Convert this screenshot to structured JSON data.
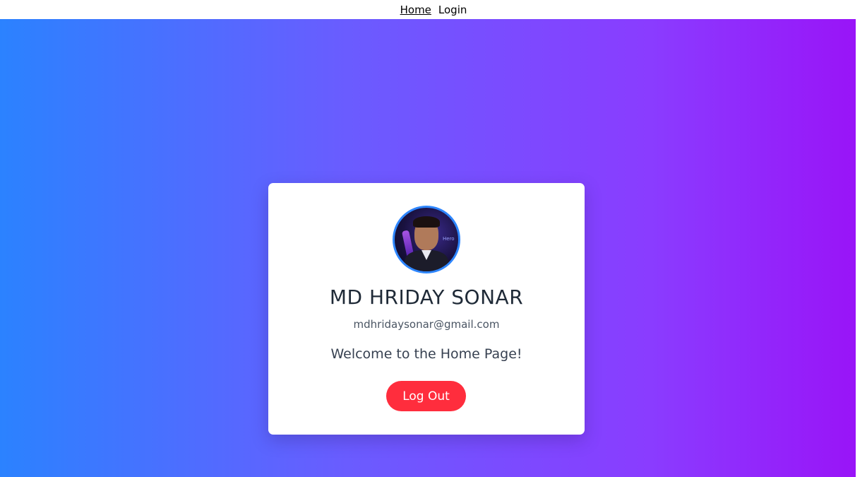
{
  "nav": {
    "home_label": "Home",
    "login_label": "Login"
  },
  "profile": {
    "name": "MD HRIDAY SONAR",
    "email": "mdhridaysonar@gmail.com",
    "welcome": "Welcome to the Home Page!",
    "avatar_caption": "Hero"
  },
  "actions": {
    "logout_label": "Log Out"
  },
  "colors": {
    "gradient_start": "#2b82ff",
    "gradient_end": "#9a12f7",
    "logout_button": "#ff2d3d",
    "avatar_border": "#2e86ff"
  }
}
